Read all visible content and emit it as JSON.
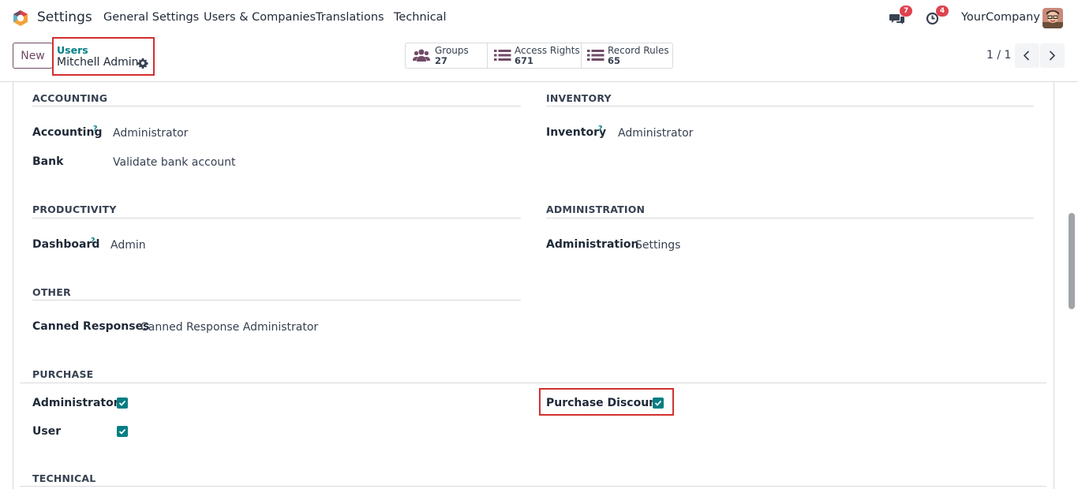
{
  "navbar": {
    "app_name": "Settings",
    "menu": [
      "General Settings",
      "Users & Companies",
      "Translations",
      "Technical"
    ],
    "messages_count": "7",
    "activities_count": "4",
    "company": "YourCompany"
  },
  "control": {
    "new_label": "New",
    "breadcrumb_parent": "Users",
    "breadcrumb_current": "Mitchell Admin",
    "smart_buttons": [
      {
        "label": "Groups",
        "value": "27",
        "icon": "users-icon"
      },
      {
        "label": "Access Rights",
        "value": "671",
        "icon": "list-icon"
      },
      {
        "label": "Record Rules",
        "value": "65",
        "icon": "list-icon"
      }
    ],
    "pager": "1 / 1"
  },
  "sections": {
    "accounting": {
      "title": "ACCOUNTING",
      "fields": [
        {
          "label": "Accounting",
          "help": "?",
          "value": "Administrator"
        },
        {
          "label": "Bank",
          "value": "Validate bank account"
        }
      ]
    },
    "inventory": {
      "title": "INVENTORY",
      "fields": [
        {
          "label": "Inventory",
          "help": "?",
          "value": "Administrator"
        }
      ]
    },
    "productivity": {
      "title": "PRODUCTIVITY",
      "fields": [
        {
          "label": "Dashboard",
          "help": "?",
          "value": "Admin"
        }
      ]
    },
    "administration": {
      "title": "ADMINISTRATION",
      "fields": [
        {
          "label": "Administration",
          "value": "Settings"
        }
      ]
    },
    "other": {
      "title": "OTHER",
      "fields": [
        {
          "label": "Canned Responses",
          "value": "Canned Response Administrator"
        }
      ]
    },
    "purchase": {
      "title": "PURCHASE",
      "fields": [
        {
          "label": "Administrator",
          "checked": true
        },
        {
          "label": "User",
          "checked": true
        },
        {
          "label": "Purchase Discount",
          "checked": true
        }
      ]
    },
    "technical": {
      "title": "TECHNICAL"
    }
  },
  "colors": {
    "brand": "#714b67",
    "accent": "#017e84",
    "highlight": "#d32f2f",
    "badge": "#e0424d"
  }
}
